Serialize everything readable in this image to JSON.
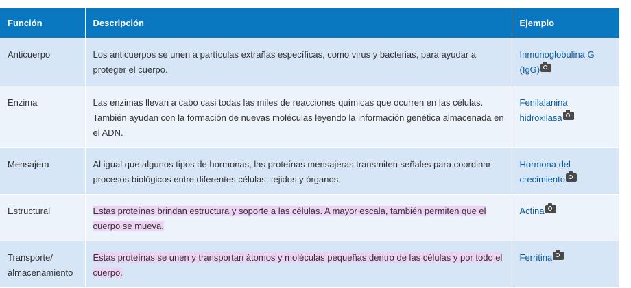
{
  "table": {
    "headers": [
      "Función",
      "Descripción",
      "Ejemplo"
    ],
    "rows": [
      {
        "function": "Anticuerpo",
        "description": "Los anticuerpos se unen a partículas extrañas específicas, como virus y bacterias, para ayudar a proteger el cuerpo.",
        "example": "Inmunoglobulina G (IgG)",
        "highlighted": false
      },
      {
        "function": "Enzima",
        "description": "Las enzimas llevan a cabo casi todas las miles de reacciones químicas que ocurren en las células. También ayudan con la formación de nuevas moléculas leyendo la información genética almacenada en el ADN.",
        "example": "Fenilalanina hidroxilasa",
        "highlighted": false
      },
      {
        "function": "Mensajera",
        "description": "Al igual que algunos tipos de hormonas, las proteínas mensajeras transmiten señales para coordinar procesos biológicos entre diferentes células, tejidos y órganos.",
        "example": "Hormona del crecimiento",
        "highlighted": false
      },
      {
        "function": "Estructural",
        "description": "Estas proteínas brindan estructura y soporte a las células. A mayor escala, también permiten que el cuerpo se mueva.",
        "example": "Actina",
        "highlighted": true
      },
      {
        "function": "Transporte/ almacenamiento",
        "description": "Estas proteínas se unen y transportan átomos y moléculas pequeñas dentro de las células y por todo el cuerpo.",
        "example": "Ferritina",
        "highlighted": true
      }
    ],
    "example_icon": "camera-icon"
  },
  "colors": {
    "header_bg": "#0a78c1",
    "row_odd_bg": "#d7e6f7",
    "row_even_bg": "#ecf3fb",
    "highlight": "#eed2f4",
    "link": "#0b5c9e"
  }
}
